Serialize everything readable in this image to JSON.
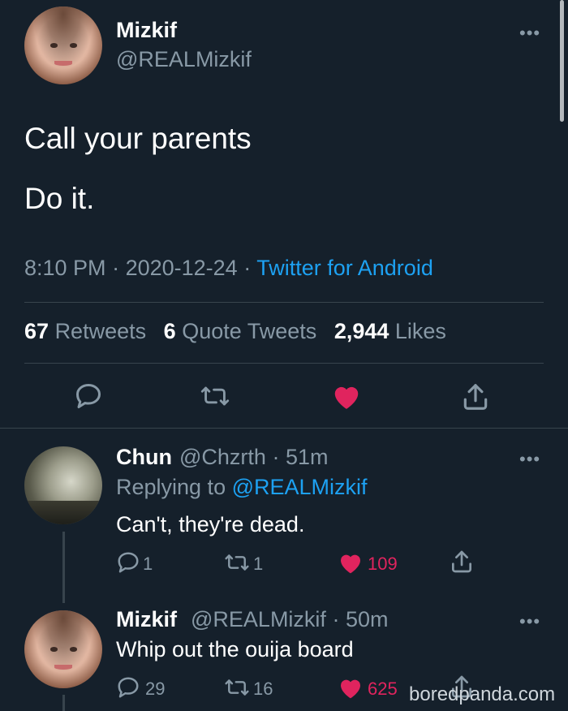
{
  "main_tweet": {
    "name": "Mizkif",
    "handle": "@REALMizkif",
    "more": "•••",
    "line1": "Call your parents",
    "line2": "Do it.",
    "time": "8:10 PM",
    "date": "2020-12-24",
    "source": "Twitter for Android",
    "retweets_count": "67",
    "retweets_label": "Retweets",
    "quotes_count": "6",
    "quotes_label": "Quote Tweets",
    "likes_count": "2,944",
    "likes_label": "Likes",
    "icons": [
      "reply-icon",
      "retweet-icon",
      "like-icon-filled",
      "share-icon"
    ],
    "like_color": "#e0245e"
  },
  "replies": [
    {
      "name": "Chun",
      "handle": "@Chzrth",
      "age": "· 51m",
      "replying_prefix": "Replying to",
      "replying_to": "@REALMizkif",
      "text": "Can't, they're dead.",
      "reply_count": "1",
      "retweet_count": "1",
      "like_count": "109",
      "more": "•••"
    },
    {
      "name": "Mizkif",
      "handle": "@REALMizkif",
      "age": "· 50m",
      "text": "Whip out the ouija board",
      "reply_count": "29",
      "retweet_count": "16",
      "like_count": "625",
      "more": "•••"
    }
  ],
  "watermark": "boredpanda.com",
  "colors": {
    "background": "#15202b",
    "accent": "#1da1f2",
    "secondary_text": "#8899a6",
    "divider": "#38444d",
    "like": "#e0245e"
  }
}
